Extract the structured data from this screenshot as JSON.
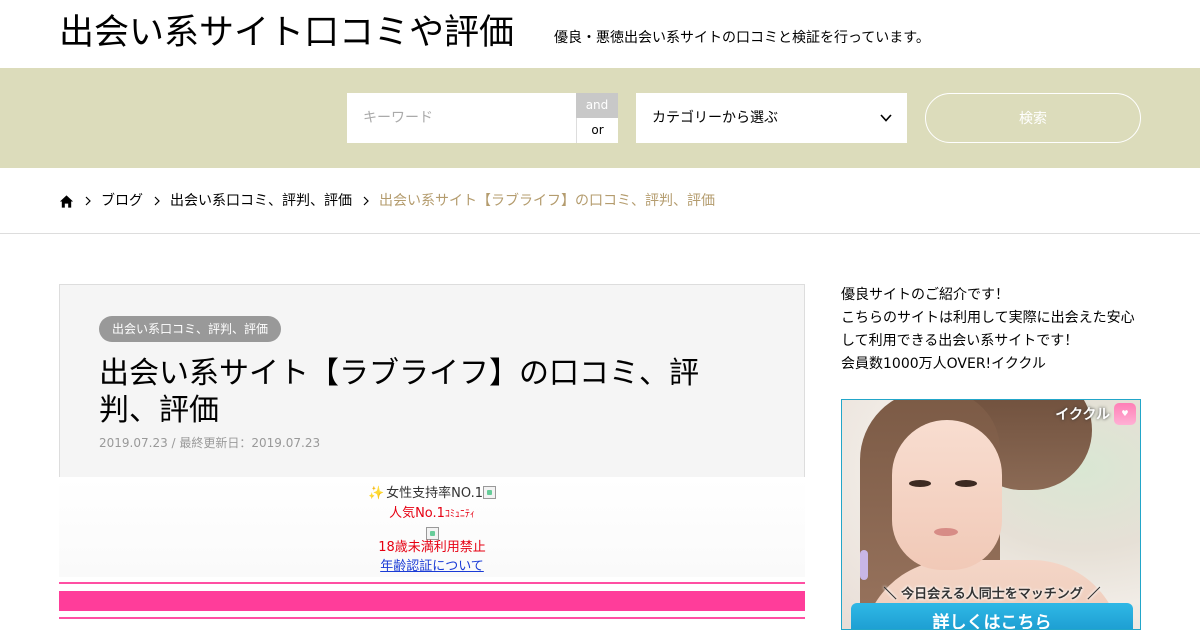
{
  "header": {
    "site_title": "出会い系サイト口コミや評価",
    "site_description": "優良・悪徳出会い系サイトの口コミと検証を行っています。"
  },
  "search": {
    "keyword_placeholder": "キーワード",
    "and_label": "and",
    "or_label": "or",
    "category_label": "カテゴリーから選ぶ",
    "search_button": "検索"
  },
  "breadcrumb": {
    "items": [
      "ブログ",
      "出会い系口コミ、評判、評価"
    ],
    "current": "出会い系サイト【ラブライフ】の口コミ、評判、評価"
  },
  "article": {
    "category_badge": "出会い系口コミ、評判、評価",
    "title": "出会い系サイト【ラブライフ】の口コミ、評判、評価",
    "date": "2019.07.23 / 最終更新日：2019.07.23",
    "ad": {
      "line1": "女性支持率NO.1",
      "line2_main": "人気No.1",
      "line2_small": "ｺﾐｭﾆﾃｨ",
      "age_notice": "18歳未満利用禁止",
      "age_link": "年齢認証について"
    }
  },
  "sidebar": {
    "intro_lines": [
      "優良サイトのご紹介です！",
      "こちらのサイトは利用して実際に出会えた安心",
      "して利用できる出会い系サイトです！",
      "会員数1000万人OVER!イククル"
    ],
    "banner": {
      "brand": "イククル",
      "tagline": "＼ 今日会える人同士をマッチング ／",
      "cta": "詳しくはこちら"
    }
  },
  "colors": {
    "search_bar_bg": "#dcdcbb",
    "breadcrumb_current": "#b49c6e",
    "pink_accent": "#ff3d9a",
    "cta_blue": "#1592c8"
  }
}
